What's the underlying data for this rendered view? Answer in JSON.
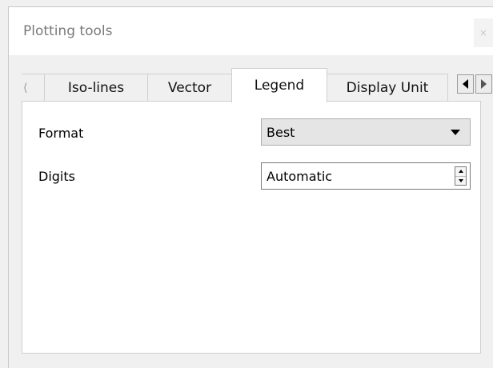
{
  "window": {
    "title": "Plotting tools",
    "close_glyph": "×"
  },
  "tabs": [
    {
      "label": "⟨",
      "partial": true
    },
    {
      "label": "Iso-lines"
    },
    {
      "label": "Vector"
    },
    {
      "label": "Legend",
      "active": true
    },
    {
      "label": "Display Unit"
    }
  ],
  "tab_scroll": {
    "left_icon": "triangle-left-icon",
    "right_icon": "triangle-right-icon"
  },
  "form": {
    "format": {
      "label": "Format",
      "value": "Best"
    },
    "digits": {
      "label": "Digits",
      "value": "Automatic"
    }
  },
  "colors": {
    "panel": "#ffffff",
    "window": "#f0f0f0",
    "title_text": "#7a7a7a"
  }
}
